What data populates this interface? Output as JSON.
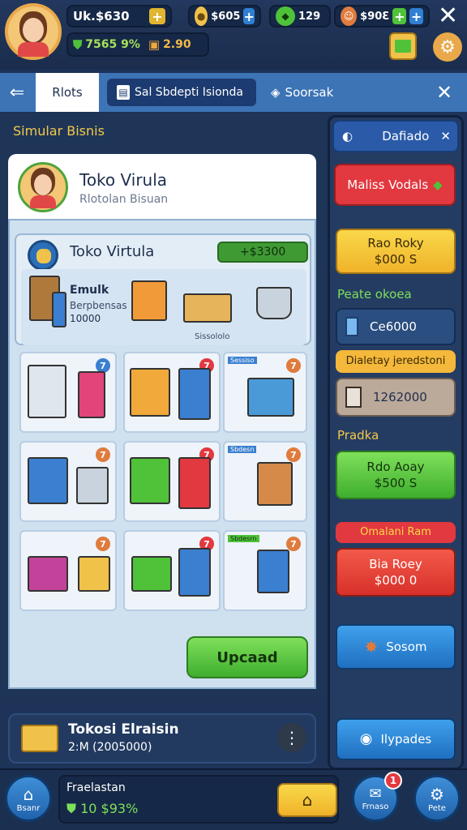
{
  "hud": {
    "money": "Uk.$630",
    "res1": "$605",
    "res2": "129",
    "res3": "$90Ɛ",
    "status_value": "7565 9%",
    "status_value2": "2.90"
  },
  "tabs": [
    {
      "label": "Rlots"
    },
    {
      "label": "Sal Sbdepti Isionda"
    },
    {
      "label": "Soorsak"
    }
  ],
  "page_title": "Simular Bisnis",
  "header_card": {
    "title": "Toko Virula",
    "subtitle": "Rlotolan Bisuan"
  },
  "store": {
    "title": "Toko Virtula",
    "value": "+$3300",
    "detail_title": "Emulk",
    "detail_sub": "Berpbensas",
    "detail_value": "10000",
    "caption": "Sissololo"
  },
  "tile_badges": [
    "7",
    "7",
    "7",
    "7",
    "7",
    "7",
    "7",
    "7",
    "7"
  ],
  "tile_tags": [
    "Sessiso",
    "Sbdesn",
    "Sbdesrn"
  ],
  "upgrade_label": "Upcaad",
  "location": {
    "title": "Tokosi Elraisin",
    "sub": "2:M (2005000)"
  },
  "sidebar": {
    "header": "Dafiado",
    "btn_red": "Maliss Vodals",
    "btn_yellow_line1": "Rao Roky",
    "btn_yellow_line2": "$000 S",
    "section1": "Peate okoea",
    "stat1": "Ce6000",
    "banner": "Dialetay jeredstoni",
    "stat2": "1262000",
    "section2": "Pradka",
    "btn_green_line1": "Rdo Aoay",
    "btn_green_line2": "$500 S",
    "banner2": "Omalani Ram",
    "btn_red2_line1": "Bia Roey",
    "btn_red2_line2": "$000 0",
    "btn_blue": "Sosom",
    "btn_blue2": "Ilypades"
  },
  "bottom": {
    "home_label": "Bsanr",
    "status_title": "Fraelastan",
    "status_value": "10 $93%",
    "btn2_label": "Frnaso",
    "settings_label": "Pete",
    "notif_count": "1"
  },
  "colors": {
    "accent_yellow": "#f7c93a",
    "accent_green": "#4fc23a",
    "accent_red": "#e2383f",
    "accent_blue": "#2b86d6",
    "panel_dark": "#1f3558"
  }
}
